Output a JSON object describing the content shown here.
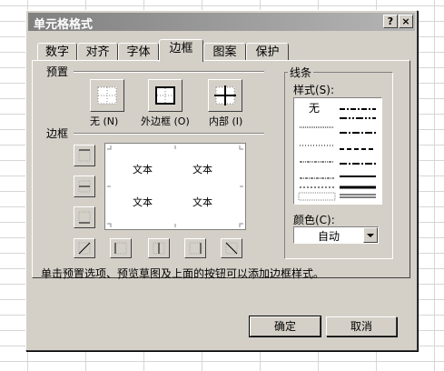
{
  "window": {
    "title": "单元格格式",
    "help_button": "?",
    "close_button": "×"
  },
  "tabs": [
    {
      "label": "数字",
      "active": false
    },
    {
      "label": "对齐",
      "active": false
    },
    {
      "label": "字体",
      "active": false
    },
    {
      "label": "边框",
      "active": true
    },
    {
      "label": "图案",
      "active": false
    },
    {
      "label": "保护",
      "active": false
    }
  ],
  "presets": {
    "label": "预置",
    "items": [
      {
        "label": "无 (N)",
        "icon": "border-none-icon"
      },
      {
        "label": "外边框 (O)",
        "icon": "border-outline-icon"
      },
      {
        "label": "内部 (I)",
        "icon": "border-inside-icon"
      }
    ]
  },
  "border": {
    "label": "边框",
    "preview_text": [
      "文本",
      "文本",
      "文本",
      "文本"
    ]
  },
  "line": {
    "group_label": "线条",
    "style_label": "样式(S):",
    "none_option": "无",
    "color_label": "颜色(C):",
    "color_value": "自动"
  },
  "help_text": "单击预置选项、预览草图及上面的按钮可以添加边框样式。",
  "buttons": {
    "ok": "确定",
    "cancel": "取消"
  }
}
